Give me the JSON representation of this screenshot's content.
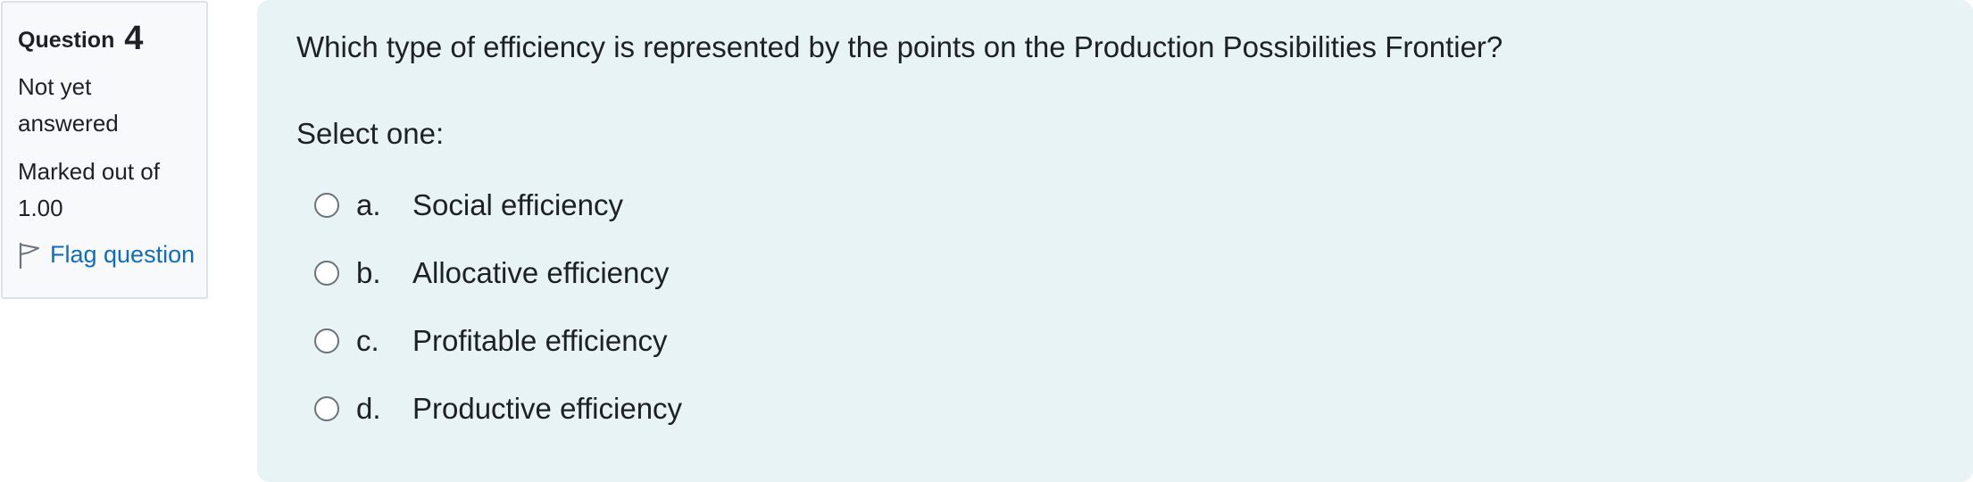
{
  "info": {
    "question_label": "Question",
    "question_number": "4",
    "state": "Not yet answered",
    "grade": "Marked out of 1.00",
    "flag_label": "Flag question"
  },
  "question": {
    "text": "Which type of efficiency is represented by the points on the Production Possibilities Frontier?",
    "prompt": "Select one:",
    "answers": [
      {
        "letter": "a.",
        "text": "Social efficiency"
      },
      {
        "letter": "b.",
        "text": "Allocative efficiency"
      },
      {
        "letter": "c.",
        "text": "Profitable efficiency"
      },
      {
        "letter": "d.",
        "text": "Productive efficiency"
      }
    ]
  },
  "colors": {
    "info_background": "#f8f9fa",
    "content_background": "#e7f3f5",
    "link": "#0f6cbf"
  }
}
